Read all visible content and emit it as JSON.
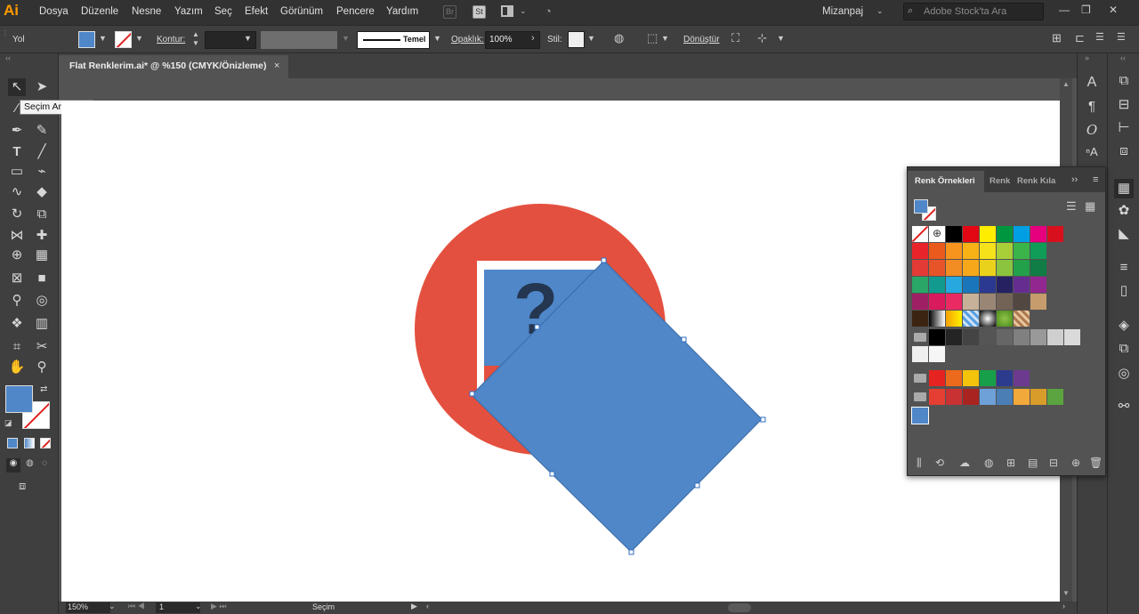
{
  "app": {
    "logo": "Ai"
  },
  "menu": [
    "Dosya",
    "Düzenle",
    "Nesne",
    "Yazım",
    "Seç",
    "Efekt",
    "Görünüm",
    "Pencere",
    "Yardım"
  ],
  "menubar_icons": {
    "bridge": "Br",
    "stock": "St"
  },
  "workspace": "Mizanpaj",
  "search": {
    "placeholder": "Adobe Stock'ta Ara"
  },
  "window_controls": [
    "—",
    "❐",
    "✕"
  ],
  "control": {
    "object_type": "Yol",
    "stroke_label": "Kontur:",
    "stroke_style": "Temel",
    "opacity_label": "Opaklık:",
    "opacity_value": "100%",
    "style_label": "Stil:",
    "transform_label": "Dönüştür",
    "fill_color": "#4f87c8"
  },
  "document_tab": {
    "title": "Flat Renklerim.ai* @ %150 (CMYK/Önizleme)",
    "close": "×"
  },
  "tooltip": "Seçim Aracı (V)",
  "tools": [
    "selection-tool",
    "direct-selection-tool",
    "magic-wand-tool",
    "lasso-tool",
    "pen-tool",
    "curvature-tool",
    "type-tool",
    "line-tool",
    "rectangle-tool",
    "paintbrush-tool",
    "shaper-tool",
    "eraser-tool",
    "rotate-tool",
    "scale-tool",
    "width-tool",
    "free-transform-tool",
    "shape-builder-tool",
    "perspective-grid-tool",
    "mesh-tool",
    "gradient-tool",
    "eyedropper-tool",
    "blend-tool",
    "symbol-sprayer-tool",
    "column-graph-tool",
    "artboard-tool",
    "slice-tool",
    "hand-tool",
    "zoom-tool"
  ],
  "status": {
    "zoom": "150%",
    "page": "1",
    "tool": "Seçim"
  },
  "swatches_panel": {
    "tabs": [
      "Renk Örnekleri",
      "Renk",
      "Renk Kıla"
    ],
    "rows": [
      [
        "#e8242a",
        "#ea5a1c",
        "#f7941d",
        "#f9b216",
        "#f5e21a",
        "#a8cf38",
        "#3bb44a",
        "#0f9d58"
      ],
      [
        "#e33a36",
        "#e8542a",
        "#f18d22",
        "#f7a81a",
        "#ead21c",
        "#8bc43f",
        "#22a14a",
        "#0f7d45"
      ],
      [
        "#2aa667",
        "#129a8f",
        "#27a8df",
        "#1b75bb",
        "#2b3990",
        "#262262",
        "#662d91",
        "#92278f"
      ],
      [
        "#9e1f63",
        "#d91a5d",
        "#ea2a63",
        "#c7b299",
        "#998675",
        "#736357",
        "#534741",
        "#c69c6d"
      ],
      [
        "#a67c52",
        "#8c6239",
        "#754c24",
        "#603913"
      ],
      [
        "#000000",
        "#242424",
        "#444444",
        "#555555",
        "#666666",
        "#808080",
        "#999999",
        "#b3b3b3"
      ],
      [
        "#e52421",
        "#ec6a1c",
        "#f3c30c",
        "#17a049",
        "#2d3b8f",
        "#6c3a8e"
      ],
      [
        "#e53e33",
        "#c83232",
        "#a92420",
        "#6fa1d9",
        "#4a7eb5",
        "#f2a93b",
        "#d89c2a",
        "#5ba43f"
      ]
    ],
    "gray_extra": [
      "#cfcfcf",
      "#dadada"
    ],
    "white_row": [
      "#efefef",
      "#f6f6f6"
    ],
    "row0": [
      "none",
      "registration",
      "#000000",
      "#e30613",
      "#ffed00",
      "#00963f",
      "#009fe3",
      "#e6007e",
      "#d80f1c"
    ],
    "selected_swatch": "#4f87c8"
  },
  "artwork": {
    "circle_color": "#e4503f",
    "tile_color": "#4f87c8",
    "frame_color": "#ffffff",
    "question_mark": "?",
    "question_color": "#243650"
  },
  "icons": {
    "dock_right": [
      "character-icon",
      "paragraph-icon",
      "opentype-icon",
      "glyphs-icon"
    ],
    "dock_far": [
      "pathfinder-icon",
      "align-icon",
      "align2-icon",
      "transform-icon",
      "swatches-icon",
      "brushes-icon",
      "symbols-icon",
      "stroke-icon",
      "gradient-icon",
      "layers-icon",
      "artboards-icon",
      "appearance-icon",
      "links-icon"
    ]
  }
}
